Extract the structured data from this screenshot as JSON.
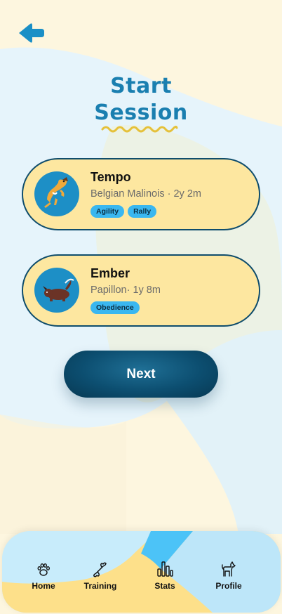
{
  "title": {
    "line1": "Start",
    "line2": "Session"
  },
  "back": {
    "icon": "arrow-left-icon"
  },
  "dogs": [
    {
      "name": "Tempo",
      "breed_age": "Belgian Malinois · 2y 2m",
      "tags": [
        "Agility",
        "Rally"
      ],
      "avatar": "jumping-dog-illustration"
    },
    {
      "name": "Ember",
      "breed_age": "Papillon· 1y 8m",
      "tags": [
        "Obedience"
      ],
      "avatar": "playing-dog-illustration"
    }
  ],
  "next_label": "Next",
  "nav": {
    "items": [
      {
        "label": "Home",
        "icon": "paw-icon"
      },
      {
        "label": "Training",
        "icon": "bone-icon"
      },
      {
        "label": "Stats",
        "icon": "bar-chart-icon"
      },
      {
        "label": "Profile",
        "icon": "dog-icon"
      }
    ]
  },
  "colors": {
    "background": "#fdf6df",
    "accent": "#1a7fb0",
    "card": "#fde7a0",
    "card_border": "#0f4d6c",
    "tag": "#3ab7f0",
    "button": "#0c4e70",
    "squiggle": "#e5c13a"
  }
}
